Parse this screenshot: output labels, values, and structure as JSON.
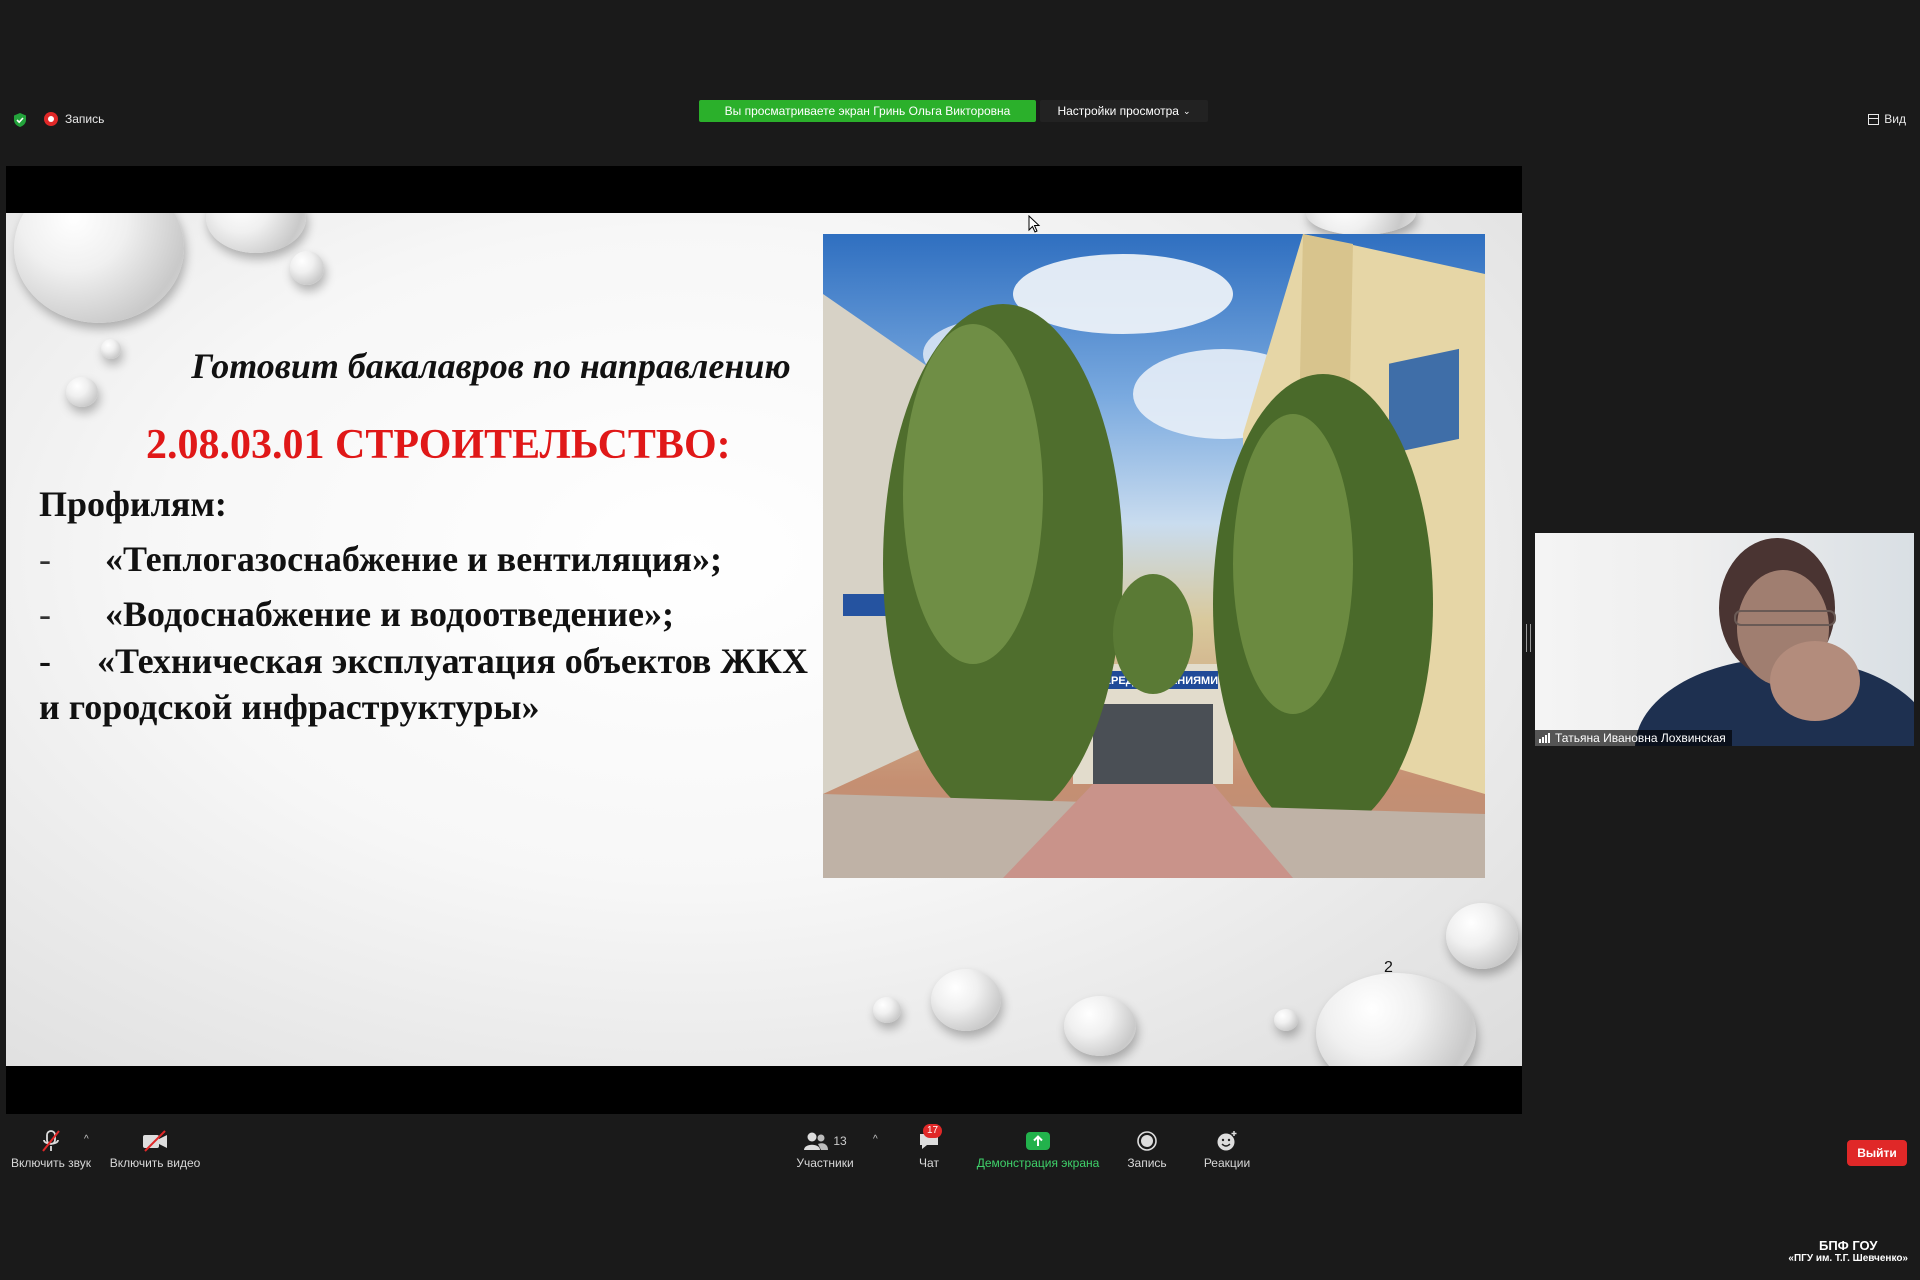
{
  "topbar": {
    "recording_label": "Запись",
    "viewing_banner": "Вы просматриваете экран Гринь Ольга Викторовна",
    "view_settings_label": "Настройки просмотра",
    "view_label": "Вид"
  },
  "slide": {
    "title": "Готовит бакалавров по направлению",
    "code": "2.08.03.01 СТРОИТЕЛЬСТВО:",
    "profiles_heading": "Профилям:",
    "profiles": [
      {
        "dash": "-",
        "text": "«Теплогазоснабжение и вентиляция»;"
      },
      {
        "dash": "-",
        "text": "«Водоснабжение и водоотведение»;"
      },
      {
        "dash": "-",
        "text": "«Техническая эксплуатация объектов ЖКХ и городской инфраструктуры»"
      }
    ],
    "photo_sign": "ВПЕРЕД ЗА ЗНАНИЯМИ",
    "page_number": "2"
  },
  "participant": {
    "name": "Татьяна Ивановна Лохвинская"
  },
  "toolbar": {
    "unmute_label": "Включить звук",
    "start_video_label": "Включить видео",
    "participants_label": "Участники",
    "participants_count": "13",
    "chat_label": "Чат",
    "chat_badge": "17",
    "share_screen_label": "Демонстрация экрана",
    "record_label": "Запись",
    "reactions_label": "Реакции",
    "leave_label": "Выйти"
  },
  "watermark": {
    "line1": "БПФ ГОУ",
    "line2": "«ПГУ им. Т.Г. Шевченко»"
  },
  "colors": {
    "background": "#1a1a1a",
    "banner_green": "#2bb02b",
    "leave_red": "#e02828",
    "accent_red_text": "#e01818",
    "share_green": "#22b24c"
  }
}
